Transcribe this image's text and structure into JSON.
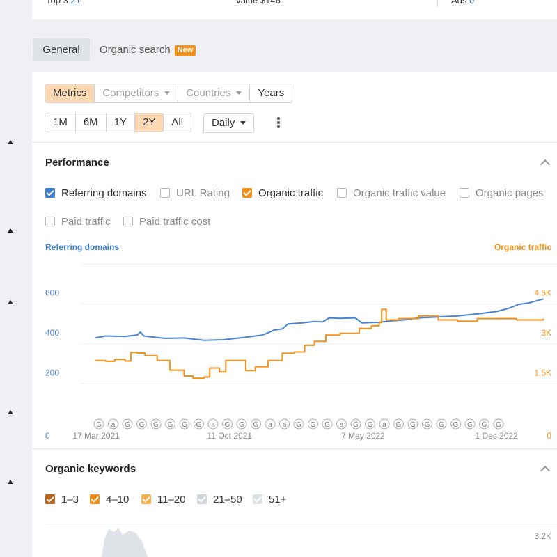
{
  "top_strip": {
    "left_text": "Top 3",
    "left_value": "21",
    "mid_text": "Value",
    "mid_value": "$146",
    "right_text": "Ads",
    "right_value": "0"
  },
  "tabs": [
    {
      "label": "General"
    },
    {
      "label": "Organic search",
      "badge": "New"
    }
  ],
  "view_modes": [
    {
      "label": "Metrics"
    },
    {
      "label": "Competitors"
    },
    {
      "label": "Countries"
    },
    {
      "label": "Years"
    }
  ],
  "ranges": [
    {
      "label": "1M"
    },
    {
      "label": "6M"
    },
    {
      "label": "1Y"
    },
    {
      "label": "2Y"
    },
    {
      "label": "All"
    }
  ],
  "interval": {
    "label": "Daily"
  },
  "performance": {
    "title": "Performance",
    "checkboxes": [
      {
        "label": "Referring domains",
        "checked": true,
        "color": "#3f7fd1"
      },
      {
        "label": "URL Rating",
        "checked": false
      },
      {
        "label": "Organic traffic",
        "checked": true,
        "color": "#f39019"
      },
      {
        "label": "Organic traffic value",
        "checked": false
      },
      {
        "label": "Organic pages",
        "checked": false
      },
      {
        "label": "Paid traffic",
        "checked": false
      },
      {
        "label": "Paid traffic cost",
        "checked": false
      }
    ],
    "left_axis_title": "Referring domains",
    "right_axis_title": "Organic traffic"
  },
  "chart_data": {
    "type": "line",
    "x_ticks": [
      "17 Mar 2021",
      "11 Oct 2021",
      "7 May 2022",
      "1 Dec 2022"
    ],
    "x_range": [
      "2021-02-21",
      "2023-02-18"
    ],
    "y_left": {
      "label": "Referring domains",
      "ticks": [
        "0",
        "200",
        "400",
        "600",
        "800"
      ],
      "range": [
        0,
        800
      ],
      "color": "#4a82d4"
    },
    "y_right": {
      "label": "Organic traffic",
      "ticks": [
        "0",
        "1.5K",
        "3K",
        "4.5K",
        "6K"
      ],
      "range": [
        0,
        6000
      ],
      "color": "#f39019"
    },
    "grid": true,
    "series": [
      {
        "name": "Referring domains",
        "axis": "left",
        "color": "#4a82d4",
        "points": [
          [
            "2021-03-15",
            430
          ],
          [
            "2021-04-01",
            440
          ],
          [
            "2021-05-01",
            438
          ],
          [
            "2021-05-20",
            445
          ],
          [
            "2021-05-25",
            460
          ],
          [
            "2021-05-30",
            440
          ],
          [
            "2021-07-01",
            428
          ],
          [
            "2021-08-01",
            430
          ],
          [
            "2021-09-01",
            418
          ],
          [
            "2021-10-01",
            421
          ],
          [
            "2021-11-01",
            432
          ],
          [
            "2021-12-01",
            444
          ],
          [
            "2021-12-20",
            470
          ],
          [
            "2022-01-01",
            475
          ],
          [
            "2022-01-10",
            500
          ],
          [
            "2022-02-01",
            505
          ],
          [
            "2022-02-20",
            512
          ],
          [
            "2022-03-05",
            510
          ],
          [
            "2022-03-15",
            530
          ],
          [
            "2022-04-01",
            528
          ],
          [
            "2022-04-25",
            530
          ],
          [
            "2022-05-05",
            505
          ],
          [
            "2022-06-01",
            508
          ],
          [
            "2022-06-20",
            515
          ],
          [
            "2022-07-10",
            520
          ],
          [
            "2022-08-01",
            530
          ],
          [
            "2022-09-01",
            535
          ],
          [
            "2022-10-01",
            540
          ],
          [
            "2022-11-01",
            550
          ],
          [
            "2022-12-01",
            562
          ],
          [
            "2022-12-20",
            578
          ],
          [
            "2023-01-05",
            598
          ],
          [
            "2023-01-20",
            605
          ],
          [
            "2023-02-12",
            625
          ]
        ]
      },
      {
        "name": "Organic traffic",
        "axis": "right",
        "color": "#f39019",
        "points": [
          [
            "2021-03-15",
            2380
          ],
          [
            "2021-04-01",
            2350
          ],
          [
            "2021-04-15",
            2420
          ],
          [
            "2021-05-01",
            2360
          ],
          [
            "2021-05-10",
            2680
          ],
          [
            "2021-05-20",
            2660
          ],
          [
            "2021-06-01",
            2560
          ],
          [
            "2021-06-20",
            2380
          ],
          [
            "2021-07-10",
            2020
          ],
          [
            "2021-08-01",
            1800
          ],
          [
            "2021-08-15",
            1720
          ],
          [
            "2021-09-01",
            1760
          ],
          [
            "2021-09-10",
            2100
          ],
          [
            "2021-09-25",
            1950
          ],
          [
            "2021-10-05",
            2380
          ],
          [
            "2021-10-25",
            2380
          ],
          [
            "2021-11-05",
            2000
          ],
          [
            "2021-11-20",
            2150
          ],
          [
            "2021-12-10",
            2380
          ],
          [
            "2022-01-01",
            2650
          ],
          [
            "2022-01-20",
            2700
          ],
          [
            "2022-02-05",
            2950
          ],
          [
            "2022-02-20",
            3100
          ],
          [
            "2022-03-10",
            3330
          ],
          [
            "2022-04-01",
            3400
          ],
          [
            "2022-05-01",
            3580
          ],
          [
            "2022-05-20",
            3680
          ],
          [
            "2022-06-01",
            3800
          ],
          [
            "2022-06-05",
            4300
          ],
          [
            "2022-06-12",
            3900
          ],
          [
            "2022-07-01",
            3950
          ],
          [
            "2022-08-01",
            4050
          ],
          [
            "2022-09-01",
            3900
          ],
          [
            "2022-10-01",
            3850
          ],
          [
            "2022-11-01",
            3950
          ],
          [
            "2022-12-01",
            3950
          ],
          [
            "2023-01-01",
            3900
          ],
          [
            "2023-02-12",
            3950
          ]
        ]
      }
    ],
    "annotations": [
      "G",
      "a",
      "G",
      "G",
      "G",
      "G",
      "G",
      "G",
      "a",
      "G",
      "G",
      "G",
      "a",
      "a",
      "G",
      "G",
      "G",
      "a",
      "G",
      "G",
      "a",
      "G",
      "G",
      "G",
      "G",
      "G",
      "G",
      "G",
      "G"
    ]
  },
  "organic_keywords": {
    "title": "Organic keywords",
    "checkboxes": [
      {
        "label": "1–3",
        "color": "#b5651d"
      },
      {
        "label": "4–10",
        "color": "#f08c1a"
      },
      {
        "label": "11–20",
        "color": "#f5b050"
      },
      {
        "label": "21–50",
        "color": "#cdd2d8"
      },
      {
        "label": "51+",
        "color": "#dde1e6"
      }
    ],
    "right_tick": "3.2K"
  }
}
